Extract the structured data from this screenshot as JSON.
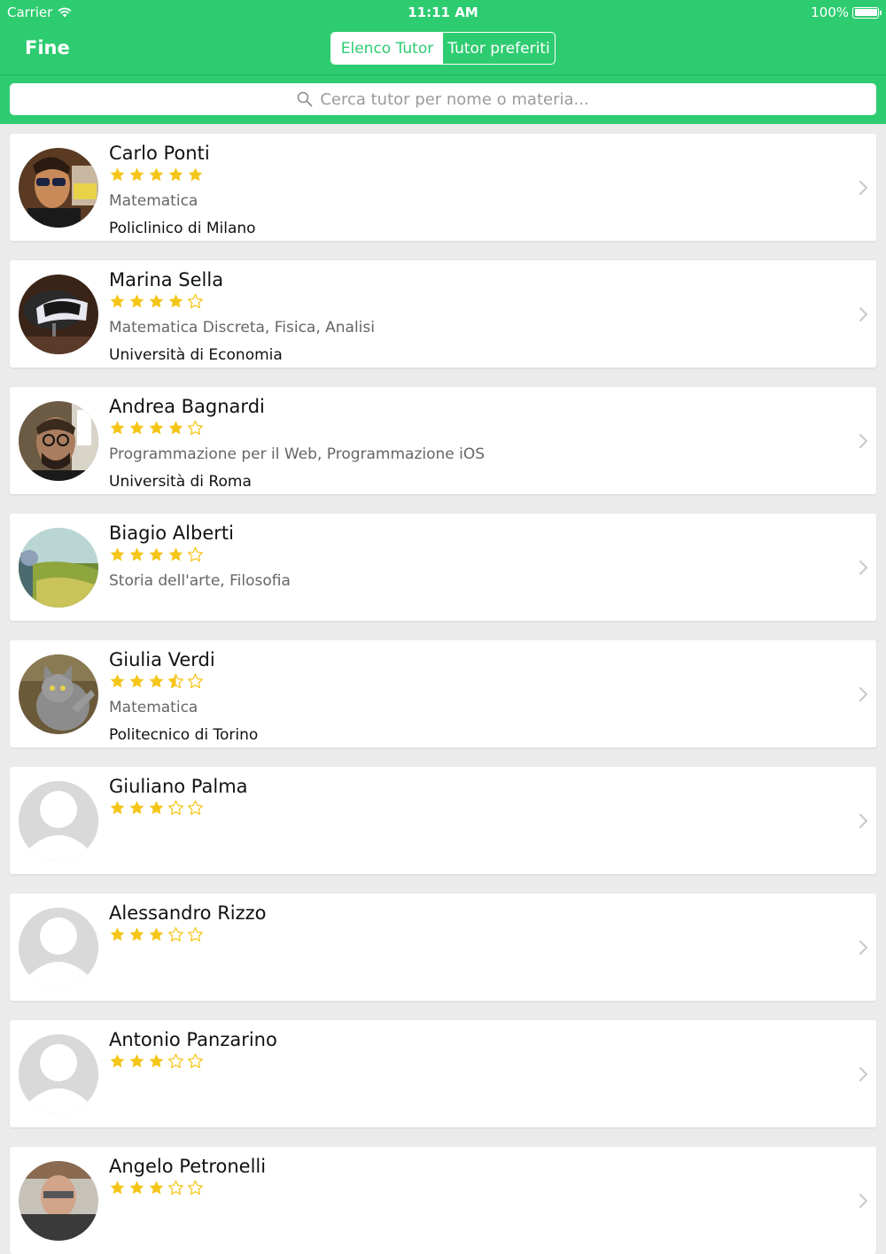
{
  "status_bar": {
    "carrier": "Carrier",
    "time": "11:11 AM",
    "battery": "100%"
  },
  "nav": {
    "left_button": "Fine",
    "segments": [
      {
        "label": "Elenco Tutor",
        "selected": true
      },
      {
        "label": "Tutor preferiti",
        "selected": false
      }
    ]
  },
  "search": {
    "placeholder": "Cerca tutor per nome o materia..."
  },
  "colors": {
    "accent": "#2ecc71",
    "star": "#f5c518",
    "chevron": "#c7c7cc"
  },
  "tutors": [
    {
      "name": "Carlo Ponti",
      "rating": 5,
      "subjects": "Matematica",
      "school": "Policlinico di Milano",
      "avatar": "photo-person-sunglasses"
    },
    {
      "name": "Marina Sella",
      "rating": 4,
      "subjects": "Matematica Discreta, Fisica, Analisi",
      "school": "Università di Economia",
      "avatar": "photo-saddle"
    },
    {
      "name": "Andrea Bagnardi",
      "rating": 4,
      "subjects": "Programmazione per il Web, Programmazione iOS",
      "school": "Università di Roma",
      "avatar": "photo-man-glasses"
    },
    {
      "name": "Biagio Alberti",
      "rating": 4,
      "subjects": "Storia dell'arte, Filosofia",
      "school": "",
      "avatar": "photo-landscape"
    },
    {
      "name": "Giulia Verdi",
      "rating": 3.5,
      "subjects": "Matematica",
      "school": "Politecnico di Torino",
      "avatar": "photo-cat"
    },
    {
      "name": "Giuliano Palma",
      "rating": 3,
      "subjects": "",
      "school": "",
      "avatar": "default-user-icon"
    },
    {
      "name": "Alessandro Rizzo",
      "rating": 3,
      "subjects": "",
      "school": "",
      "avatar": "default-user-icon"
    },
    {
      "name": "Antonio Panzarino",
      "rating": 3,
      "subjects": "",
      "school": "",
      "avatar": "default-user-icon"
    },
    {
      "name": "Angelo Petronelli",
      "rating": 3,
      "subjects": "",
      "school": "",
      "avatar": "photo-person"
    }
  ]
}
